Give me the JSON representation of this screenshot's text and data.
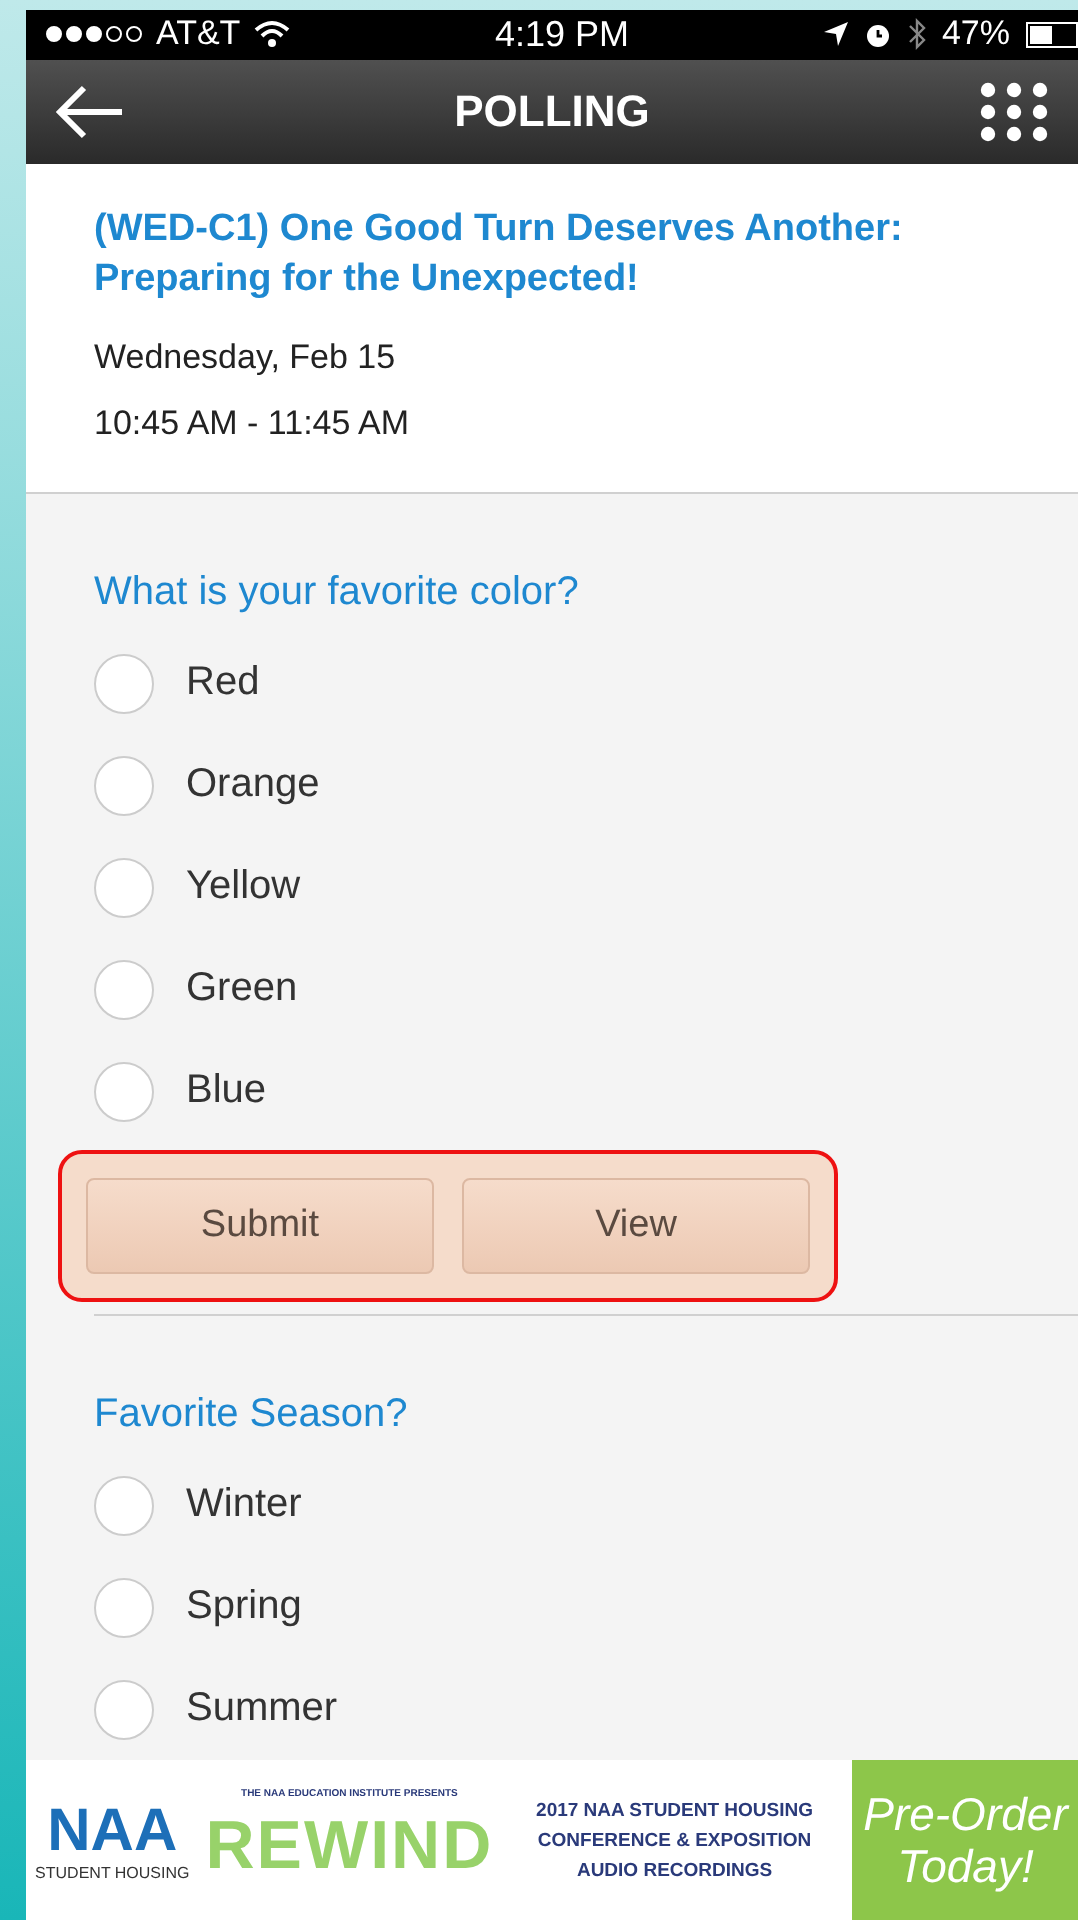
{
  "status_bar": {
    "carrier": "AT&T",
    "time": "4:19 PM",
    "battery": "47%"
  },
  "header": {
    "title": "POLLING"
  },
  "session": {
    "title": "(WED-C1) One Good Turn Deserves Another: Preparing for the Unexpected!",
    "date": "Wednesday, Feb 15",
    "time": "10:45 AM - 11:45 AM"
  },
  "polls": [
    {
      "question": "What is your favorite color?",
      "options": [
        {
          "label": "Red",
          "selected": false
        },
        {
          "label": "Orange",
          "selected": false
        },
        {
          "label": "Yellow",
          "selected": false
        },
        {
          "label": "Green",
          "selected": false
        },
        {
          "label": "Blue",
          "selected": false
        }
      ],
      "buttons": [
        "Submit",
        "View"
      ],
      "highlighted": true
    },
    {
      "question": "Favorite Season?",
      "options": [
        {
          "label": "Winter",
          "selected": false
        },
        {
          "label": "Spring",
          "selected": false
        },
        {
          "label": "Summer",
          "selected": false
        }
      ]
    }
  ],
  "banner": {
    "logo": "NAA",
    "logo_sub": "STUDENT HOUSING",
    "presents": "THE NAA EDUCATION INSTITUTE PRESENTS",
    "brand": "REWIND",
    "text": "2017 NAA STUDENT HOUSING CONFERENCE & EXPOSITION AUDIO RECORDINGS",
    "cta": "Pre-Order Today!"
  }
}
